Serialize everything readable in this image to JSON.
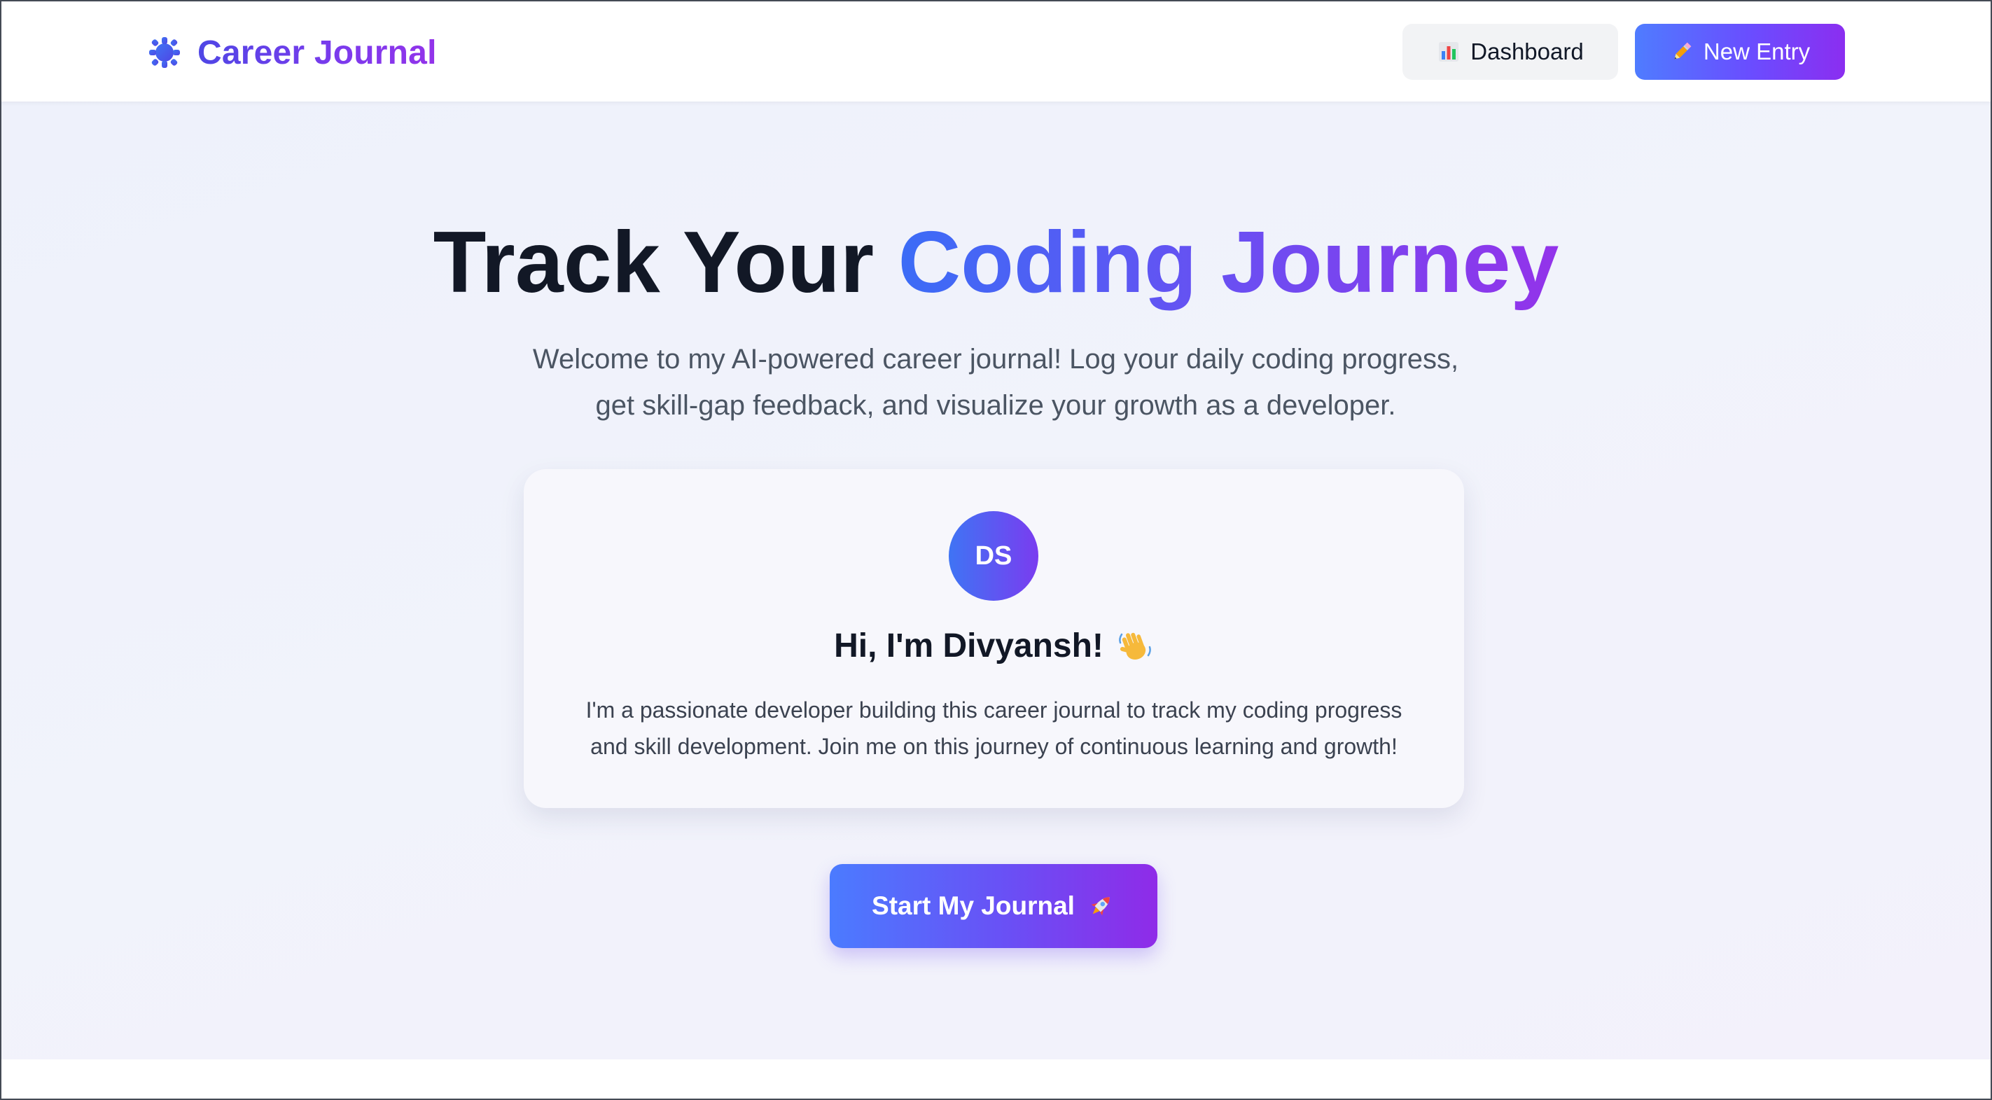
{
  "header": {
    "brand_title": "Career Journal",
    "brand_icon": "puzzle-gear-icon",
    "nav": {
      "dashboard_label": "Dashboard",
      "dashboard_icon": "bar-chart-icon",
      "new_entry_label": "New Entry",
      "new_entry_icon": "pencil-icon"
    }
  },
  "hero": {
    "title_plain": "Track Your",
    "title_highlight": "Coding Journey",
    "subtitle_line1": "Welcome to my AI-powered career journal! Log your daily coding progress,",
    "subtitle_line2": "get skill-gap feedback, and visualize your growth as a developer."
  },
  "profile": {
    "initials": "DS",
    "greeting": "Hi, I'm Divyansh!",
    "greeting_icon": "waving-hand-icon",
    "bio_line1": "I'm a passionate developer building this career journal to track my coding progress",
    "bio_line2": "and skill development. Join me on this journey of continuous learning and growth!"
  },
  "cta": {
    "label": "Start My Journal",
    "icon": "rocket-icon"
  },
  "colors": {
    "brand_gradient_start": "#4f46e5",
    "brand_gradient_end": "#9333ea",
    "primary_blue": "#3b6cf6",
    "primary_purple": "#8b2ef0",
    "hero_background": "#eef1fb",
    "text_dark": "#121826",
    "text_muted": "#4b5563"
  }
}
